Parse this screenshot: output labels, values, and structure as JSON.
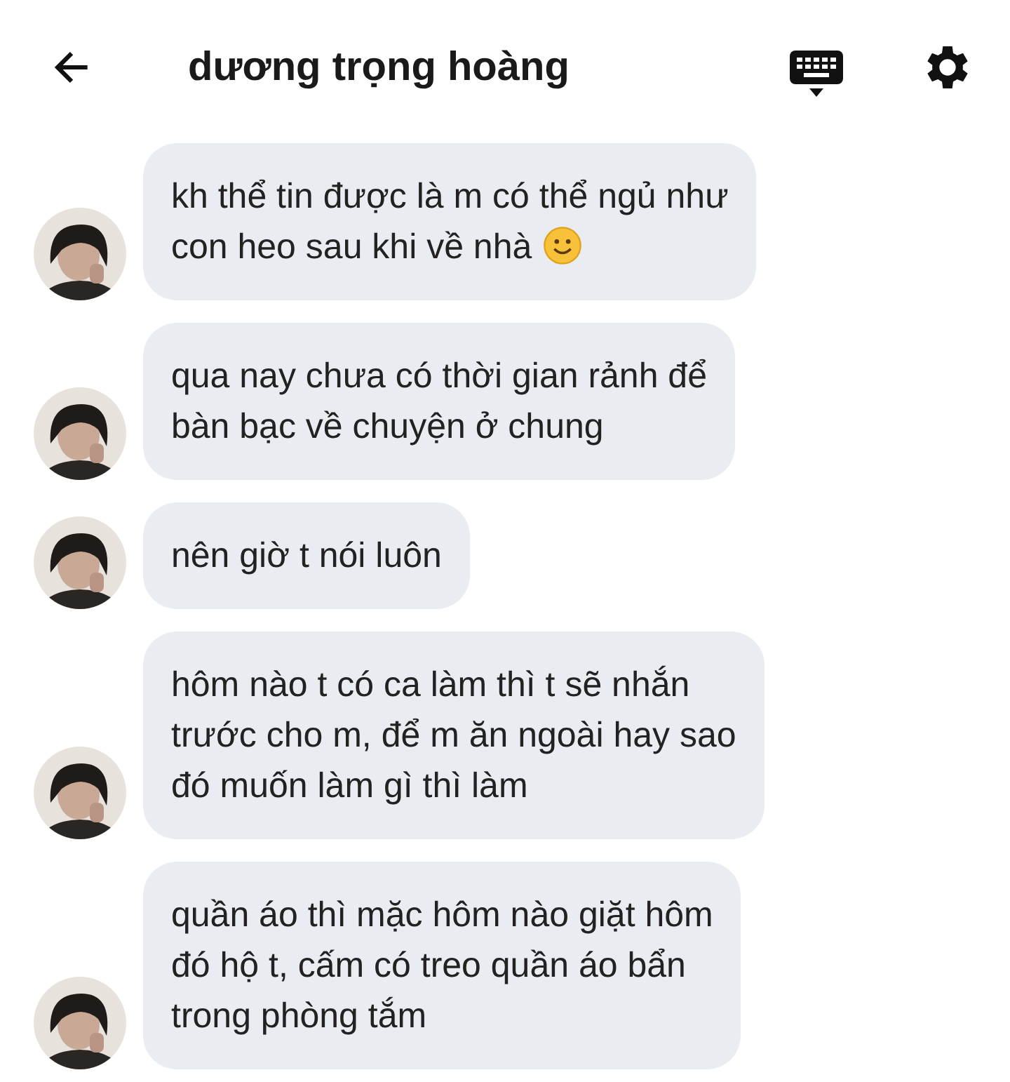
{
  "header": {
    "title": "dương trọng hoàng"
  },
  "messages": [
    {
      "text": "kh thể tin được là m có thể ngủ như\ncon heo sau khi về nhà",
      "trailing_emoji": true
    },
    {
      "text": "qua nay chưa có thời gian rảnh để\nbàn bạc về chuyện ở chung",
      "trailing_emoji": false
    },
    {
      "text": "nên giờ t nói luôn",
      "trailing_emoji": false
    },
    {
      "text": "hôm nào t có ca làm thì t sẽ nhắn\ntrước cho m, để m ăn ngoài hay sao\nđó muốn làm gì thì làm",
      "trailing_emoji": false
    },
    {
      "text": "quần áo thì mặc hôm nào giặt hôm\nđó hộ t, cấm có treo quần áo bẩn\ntrong phòng tắm",
      "trailing_emoji": false
    }
  ]
}
